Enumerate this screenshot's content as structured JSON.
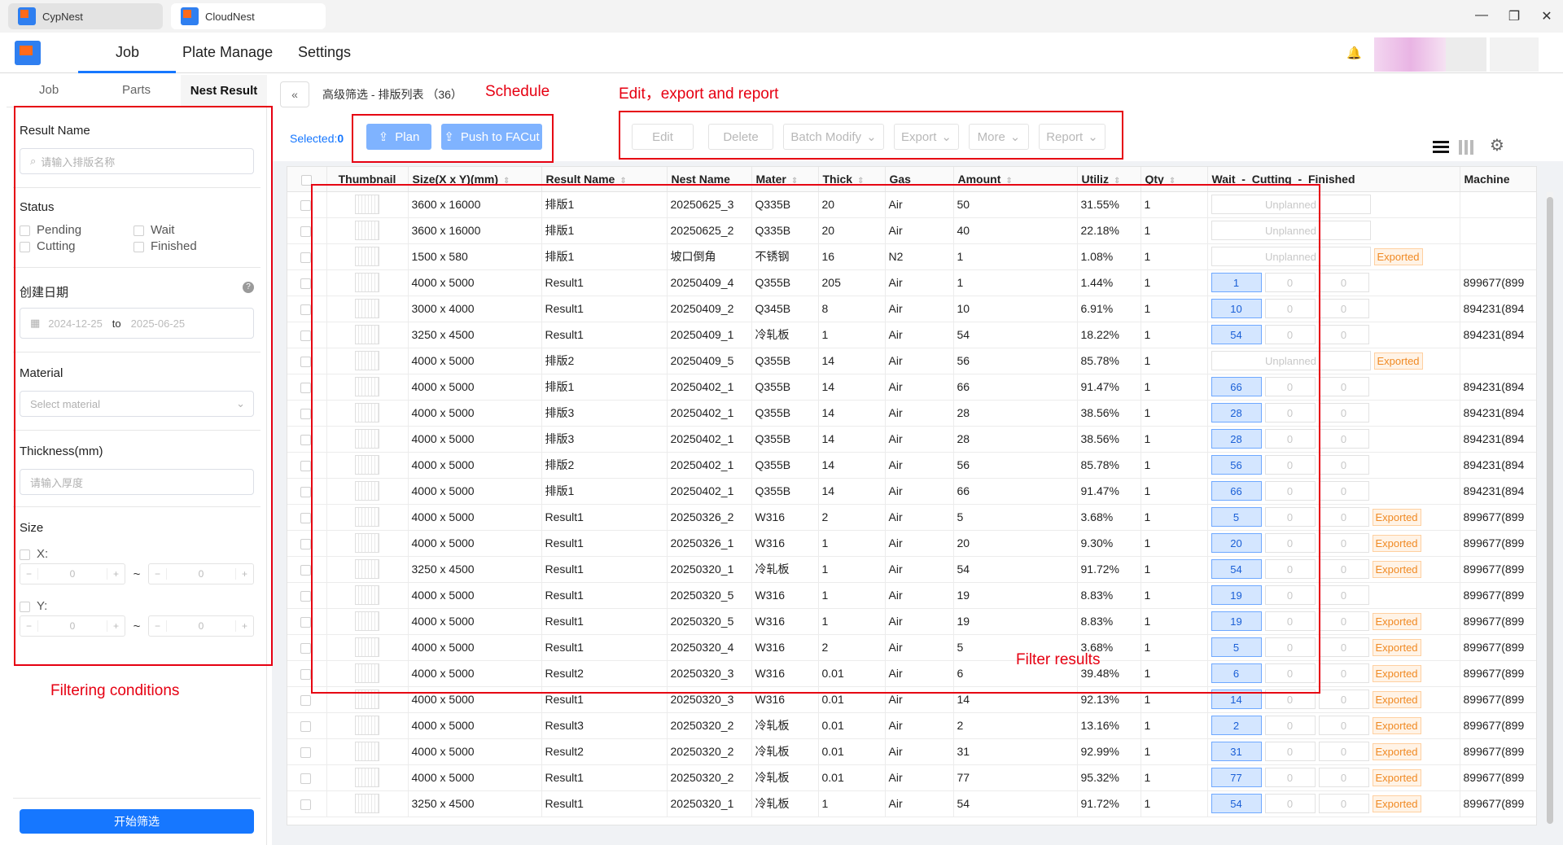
{
  "window": {
    "tabs": [
      {
        "label": "CypNest"
      },
      {
        "label": "CloudNest"
      }
    ],
    "controls": {
      "minimize": "—",
      "maximize": "❐",
      "close": "✕"
    }
  },
  "header": {
    "nav": [
      {
        "label": "Job"
      },
      {
        "label": "Plate Manage"
      },
      {
        "label": "Settings"
      }
    ],
    "bell_icon": "bell-icon"
  },
  "left": {
    "subtabs": [
      {
        "label": "Job"
      },
      {
        "label": "Parts"
      },
      {
        "label": "Nest Result"
      }
    ],
    "result_name": {
      "title": "Result Name",
      "placeholder": "请输入排版名称"
    },
    "status": {
      "title": "Status",
      "options": [
        {
          "label": "Pending"
        },
        {
          "label": "Wait"
        },
        {
          "label": "Cutting"
        },
        {
          "label": "Finished"
        }
      ]
    },
    "date": {
      "title": "创建日期",
      "from": "2024-12-25",
      "to_label": "to",
      "to": "2025-06-25",
      "help": "?"
    },
    "material": {
      "title": "Material",
      "placeholder": "Select material"
    },
    "thickness": {
      "title": "Thickness(mm)",
      "placeholder": "请输入厚度"
    },
    "size": {
      "title": "Size",
      "x_label": "X:",
      "y_label": "Y:",
      "min": "0",
      "max": "0",
      "sep": "~",
      "minus": "−",
      "plus": "+"
    },
    "start_button": "开始筛选"
  },
  "main": {
    "breadcrumb": "高级筛选 - 排版列表 （36）",
    "back_icon": "«",
    "toolbar": {
      "selected_label": "Selected:",
      "selected_count": "0",
      "plan": "Plan",
      "push": "Push to FACut",
      "edit": "Edit",
      "delete": "Delete",
      "batch_modify": "Batch Modify",
      "export": "Export",
      "more": "More",
      "report": "Report"
    },
    "columns": [
      "Thumbnail",
      "Size(X x Y)(mm)",
      "Result Name",
      "Nest Name",
      "Mater",
      "Thick",
      "Gas",
      "Amount",
      "Utiliz",
      "Qty",
      "Wait  -  Cutting  -  Finished",
      "Machine"
    ],
    "status_labels": {
      "unplanned": "Unplanned",
      "exported": "Exported"
    },
    "rows": [
      {
        "size": "3600 x 16000",
        "result": "排版1",
        "nest": "20250625_3",
        "mat": "Q335B",
        "thick": "20",
        "gas": "Air",
        "amount": "50",
        "util": "31.55%",
        "qty": "1",
        "wait": "",
        "cutting": "",
        "finished": "",
        "unplanned": true,
        "exported": false,
        "machine": ""
      },
      {
        "size": "3600 x 16000",
        "result": "排版1",
        "nest": "20250625_2",
        "mat": "Q335B",
        "thick": "20",
        "gas": "Air",
        "amount": "40",
        "util": "22.18%",
        "qty": "1",
        "wait": "",
        "cutting": "",
        "finished": "",
        "unplanned": true,
        "exported": false,
        "machine": ""
      },
      {
        "size": "1500 x 580",
        "result": "排版1",
        "nest": "坡口倒角",
        "mat": "不锈钢",
        "thick": "16",
        "gas": "N2",
        "amount": "1",
        "util": "1.08%",
        "qty": "1",
        "wait": "",
        "cutting": "",
        "finished": "",
        "unplanned": true,
        "exported": true,
        "machine": ""
      },
      {
        "size": "4000 x 5000",
        "result": "Result1",
        "nest": "20250409_4",
        "mat": "Q355B",
        "thick": "205",
        "gas": "Air",
        "amount": "1",
        "util": "1.44%",
        "qty": "1",
        "wait": "1",
        "cutting": "0",
        "finished": "0",
        "unplanned": false,
        "exported": false,
        "machine": "899677(899"
      },
      {
        "size": "3000 x 4000",
        "result": "Result1",
        "nest": "20250409_2",
        "mat": "Q345B",
        "thick": "8",
        "gas": "Air",
        "amount": "10",
        "util": "6.91%",
        "qty": "1",
        "wait": "10",
        "cutting": "0",
        "finished": "0",
        "unplanned": false,
        "exported": false,
        "machine": "894231(894"
      },
      {
        "size": "3250 x 4500",
        "result": "Result1",
        "nest": "20250409_1",
        "mat": "冷轧板",
        "thick": "1",
        "gas": "Air",
        "amount": "54",
        "util": "18.22%",
        "qty": "1",
        "wait": "54",
        "cutting": "0",
        "finished": "0",
        "unplanned": false,
        "exported": false,
        "machine": "894231(894"
      },
      {
        "size": "4000 x 5000",
        "result": "排版2",
        "nest": "20250409_5",
        "mat": "Q355B",
        "thick": "14",
        "gas": "Air",
        "amount": "56",
        "util": "85.78%",
        "qty": "1",
        "wait": "",
        "cutting": "",
        "finished": "",
        "unplanned": true,
        "exported": true,
        "machine": ""
      },
      {
        "size": "4000 x 5000",
        "result": "排版1",
        "nest": "20250402_1",
        "mat": "Q355B",
        "thick": "14",
        "gas": "Air",
        "amount": "66",
        "util": "91.47%",
        "qty": "1",
        "wait": "66",
        "cutting": "0",
        "finished": "0",
        "unplanned": false,
        "exported": false,
        "machine": "894231(894"
      },
      {
        "size": "4000 x 5000",
        "result": "排版3",
        "nest": "20250402_1",
        "mat": "Q355B",
        "thick": "14",
        "gas": "Air",
        "amount": "28",
        "util": "38.56%",
        "qty": "1",
        "wait": "28",
        "cutting": "0",
        "finished": "0",
        "unplanned": false,
        "exported": false,
        "machine": "894231(894"
      },
      {
        "size": "4000 x 5000",
        "result": "排版3",
        "nest": "20250402_1",
        "mat": "Q355B",
        "thick": "14",
        "gas": "Air",
        "amount": "28",
        "util": "38.56%",
        "qty": "1",
        "wait": "28",
        "cutting": "0",
        "finished": "0",
        "unplanned": false,
        "exported": false,
        "machine": "894231(894"
      },
      {
        "size": "4000 x 5000",
        "result": "排版2",
        "nest": "20250402_1",
        "mat": "Q355B",
        "thick": "14",
        "gas": "Air",
        "amount": "56",
        "util": "85.78%",
        "qty": "1",
        "wait": "56",
        "cutting": "0",
        "finished": "0",
        "unplanned": false,
        "exported": false,
        "machine": "894231(894"
      },
      {
        "size": "4000 x 5000",
        "result": "排版1",
        "nest": "20250402_1",
        "mat": "Q355B",
        "thick": "14",
        "gas": "Air",
        "amount": "66",
        "util": "91.47%",
        "qty": "1",
        "wait": "66",
        "cutting": "0",
        "finished": "0",
        "unplanned": false,
        "exported": false,
        "machine": "894231(894"
      },
      {
        "size": "4000 x 5000",
        "result": "Result1",
        "nest": "20250326_2",
        "mat": "W316",
        "thick": "2",
        "gas": "Air",
        "amount": "5",
        "util": "3.68%",
        "qty": "1",
        "wait": "5",
        "cutting": "0",
        "finished": "0",
        "unplanned": false,
        "exported": true,
        "machine": "899677(899"
      },
      {
        "size": "4000 x 5000",
        "result": "Result1",
        "nest": "20250326_1",
        "mat": "W316",
        "thick": "1",
        "gas": "Air",
        "amount": "20",
        "util": "9.30%",
        "qty": "1",
        "wait": "20",
        "cutting": "0",
        "finished": "0",
        "unplanned": false,
        "exported": true,
        "machine": "899677(899"
      },
      {
        "size": "3250 x 4500",
        "result": "Result1",
        "nest": "20250320_1",
        "mat": "冷轧板",
        "thick": "1",
        "gas": "Air",
        "amount": "54",
        "util": "91.72%",
        "qty": "1",
        "wait": "54",
        "cutting": "0",
        "finished": "0",
        "unplanned": false,
        "exported": true,
        "machine": "899677(899"
      },
      {
        "size": "4000 x 5000",
        "result": "Result1",
        "nest": "20250320_5",
        "mat": "W316",
        "thick": "1",
        "gas": "Air",
        "amount": "19",
        "util": "8.83%",
        "qty": "1",
        "wait": "19",
        "cutting": "0",
        "finished": "0",
        "unplanned": false,
        "exported": false,
        "machine": "899677(899"
      },
      {
        "size": "4000 x 5000",
        "result": "Result1",
        "nest": "20250320_5",
        "mat": "W316",
        "thick": "1",
        "gas": "Air",
        "amount": "19",
        "util": "8.83%",
        "qty": "1",
        "wait": "19",
        "cutting": "0",
        "finished": "0",
        "unplanned": false,
        "exported": true,
        "machine": "899677(899"
      },
      {
        "size": "4000 x 5000",
        "result": "Result1",
        "nest": "20250320_4",
        "mat": "W316",
        "thick": "2",
        "gas": "Air",
        "amount": "5",
        "util": "3.68%",
        "qty": "1",
        "wait": "5",
        "cutting": "0",
        "finished": "0",
        "unplanned": false,
        "exported": true,
        "machine": "899677(899"
      },
      {
        "size": "4000 x 5000",
        "result": "Result2",
        "nest": "20250320_3",
        "mat": "W316",
        "thick": "0.01",
        "gas": "Air",
        "amount": "6",
        "util": "39.48%",
        "qty": "1",
        "wait": "6",
        "cutting": "0",
        "finished": "0",
        "unplanned": false,
        "exported": true,
        "machine": "899677(899"
      },
      {
        "size": "4000 x 5000",
        "result": "Result1",
        "nest": "20250320_3",
        "mat": "W316",
        "thick": "0.01",
        "gas": "Air",
        "amount": "14",
        "util": "92.13%",
        "qty": "1",
        "wait": "14",
        "cutting": "0",
        "finished": "0",
        "unplanned": false,
        "exported": true,
        "machine": "899677(899"
      },
      {
        "size": "4000 x 5000",
        "result": "Result3",
        "nest": "20250320_2",
        "mat": "冷轧板",
        "thick": "0.01",
        "gas": "Air",
        "amount": "2",
        "util": "13.16%",
        "qty": "1",
        "wait": "2",
        "cutting": "0",
        "finished": "0",
        "unplanned": false,
        "exported": true,
        "machine": "899677(899"
      },
      {
        "size": "4000 x 5000",
        "result": "Result2",
        "nest": "20250320_2",
        "mat": "冷轧板",
        "thick": "0.01",
        "gas": "Air",
        "amount": "31",
        "util": "92.99%",
        "qty": "1",
        "wait": "31",
        "cutting": "0",
        "finished": "0",
        "unplanned": false,
        "exported": true,
        "machine": "899677(899"
      },
      {
        "size": "4000 x 5000",
        "result": "Result1",
        "nest": "20250320_2",
        "mat": "冷轧板",
        "thick": "0.01",
        "gas": "Air",
        "amount": "77",
        "util": "95.32%",
        "qty": "1",
        "wait": "77",
        "cutting": "0",
        "finished": "0",
        "unplanned": false,
        "exported": true,
        "machine": "899677(899"
      },
      {
        "size": "3250 x 4500",
        "result": "Result1",
        "nest": "20250320_1",
        "mat": "冷轧板",
        "thick": "1",
        "gas": "Air",
        "amount": "54",
        "util": "91.72%",
        "qty": "1",
        "wait": "54",
        "cutting": "0",
        "finished": "0",
        "unplanned": false,
        "exported": true,
        "machine": "899677(899"
      }
    ]
  },
  "annotations": {
    "schedule": "Schedule",
    "edit_export": "Edit，export and report",
    "filter_results": "Filter results",
    "filter_conditions": "Filtering conditions"
  },
  "colors": {
    "accent": "#1677ff",
    "annotation": "#e60012",
    "exported": "#f08a24",
    "wait_bg": "#d4e6ff"
  }
}
